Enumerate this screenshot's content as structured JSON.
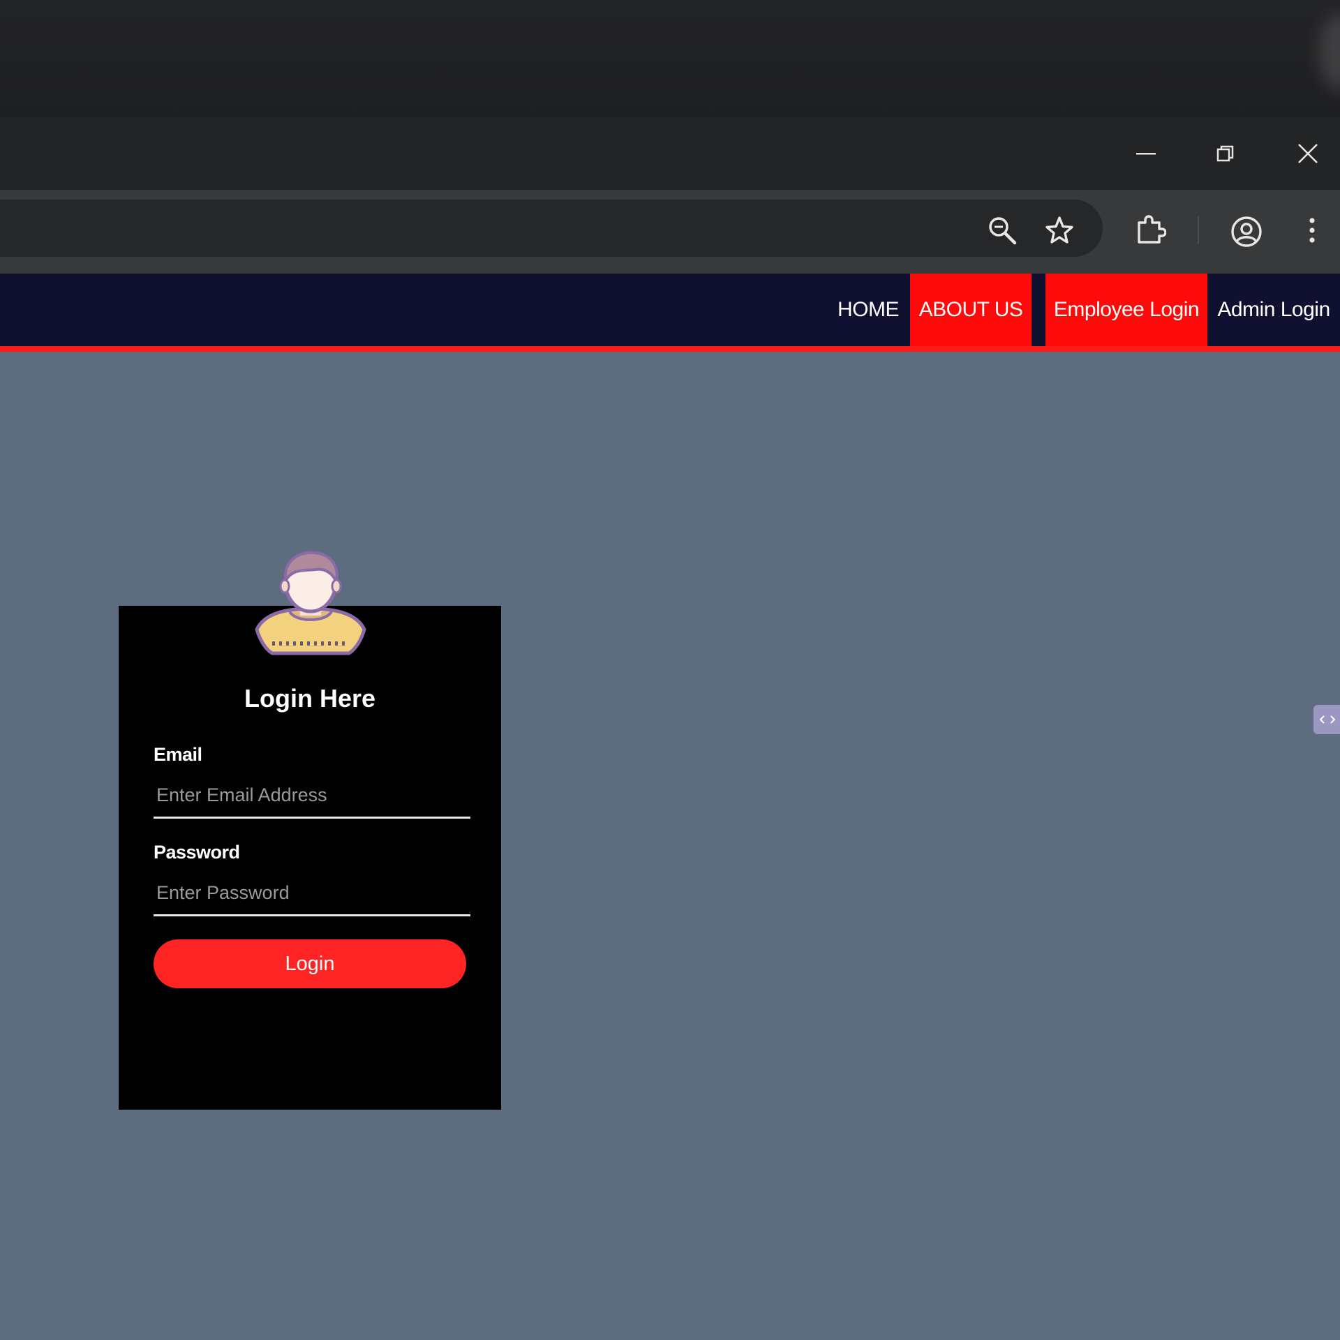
{
  "window": {
    "minimize_icon": "minimize-icon",
    "restore_icon": "restore-icon",
    "close_icon": "close-icon"
  },
  "toolbar": {
    "icons": [
      "zoom-icon",
      "star-icon",
      "extensions-icon",
      "profile-icon",
      "more-menu-icon"
    ]
  },
  "nav": {
    "home": "HOME",
    "about": "ABOUT US",
    "employee_login": "Employee Login",
    "admin_login": "Admin Login",
    "active_color": "#ff0a0a",
    "bar_color": "#101130"
  },
  "login": {
    "title": "Login Here",
    "email_label": "Email",
    "email_placeholder": "Enter Email Address",
    "password_label": "Password",
    "password_placeholder": "Enter Password",
    "button_label": "Login",
    "button_color": "#ff2424"
  },
  "colors": {
    "page_background": "#5d6c7e",
    "card_background": "#000000",
    "accent": "#ff1a1a"
  }
}
